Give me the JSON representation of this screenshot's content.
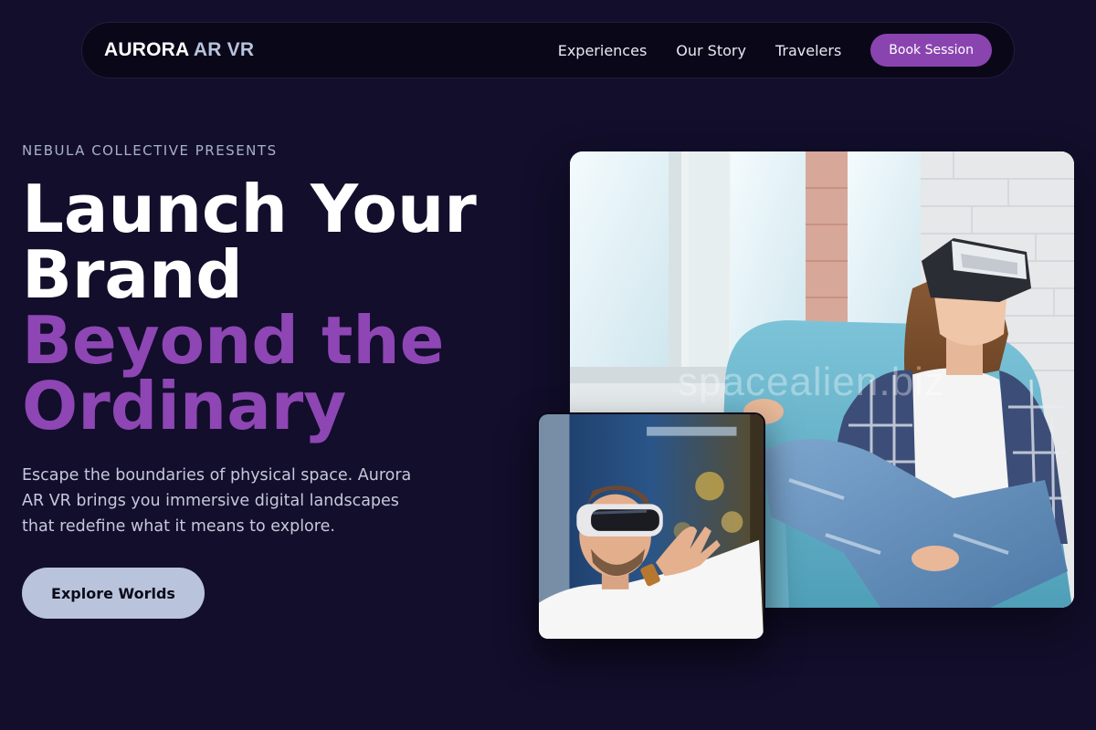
{
  "nav": {
    "brand_primary": "AURORA",
    "brand_secondary": "AR VR",
    "links": [
      "Experiences",
      "Our Story",
      "Travelers"
    ],
    "cta_label": "Book Session"
  },
  "hero": {
    "eyebrow": "NEBULA COLLECTIVE PRESENTS",
    "headline_line1": "Launch Your",
    "headline_line2": "Brand",
    "headline_line3": "Beyond the",
    "headline_line4": "Ordinary",
    "lead": "Escape the boundaries of physical space. Aurora AR VR brings you immersive digital landscapes that redefine what it means to explore.",
    "cta_label": "Explore Worlds"
  },
  "images": {
    "main_watermark": "spacealien.biz"
  },
  "colors": {
    "background": "#120e2b",
    "nav_background": "#0a0818",
    "accent_purple": "#8a44b0",
    "headline_purple": "#8e46b4",
    "cta_background": "#b9c4dc"
  }
}
